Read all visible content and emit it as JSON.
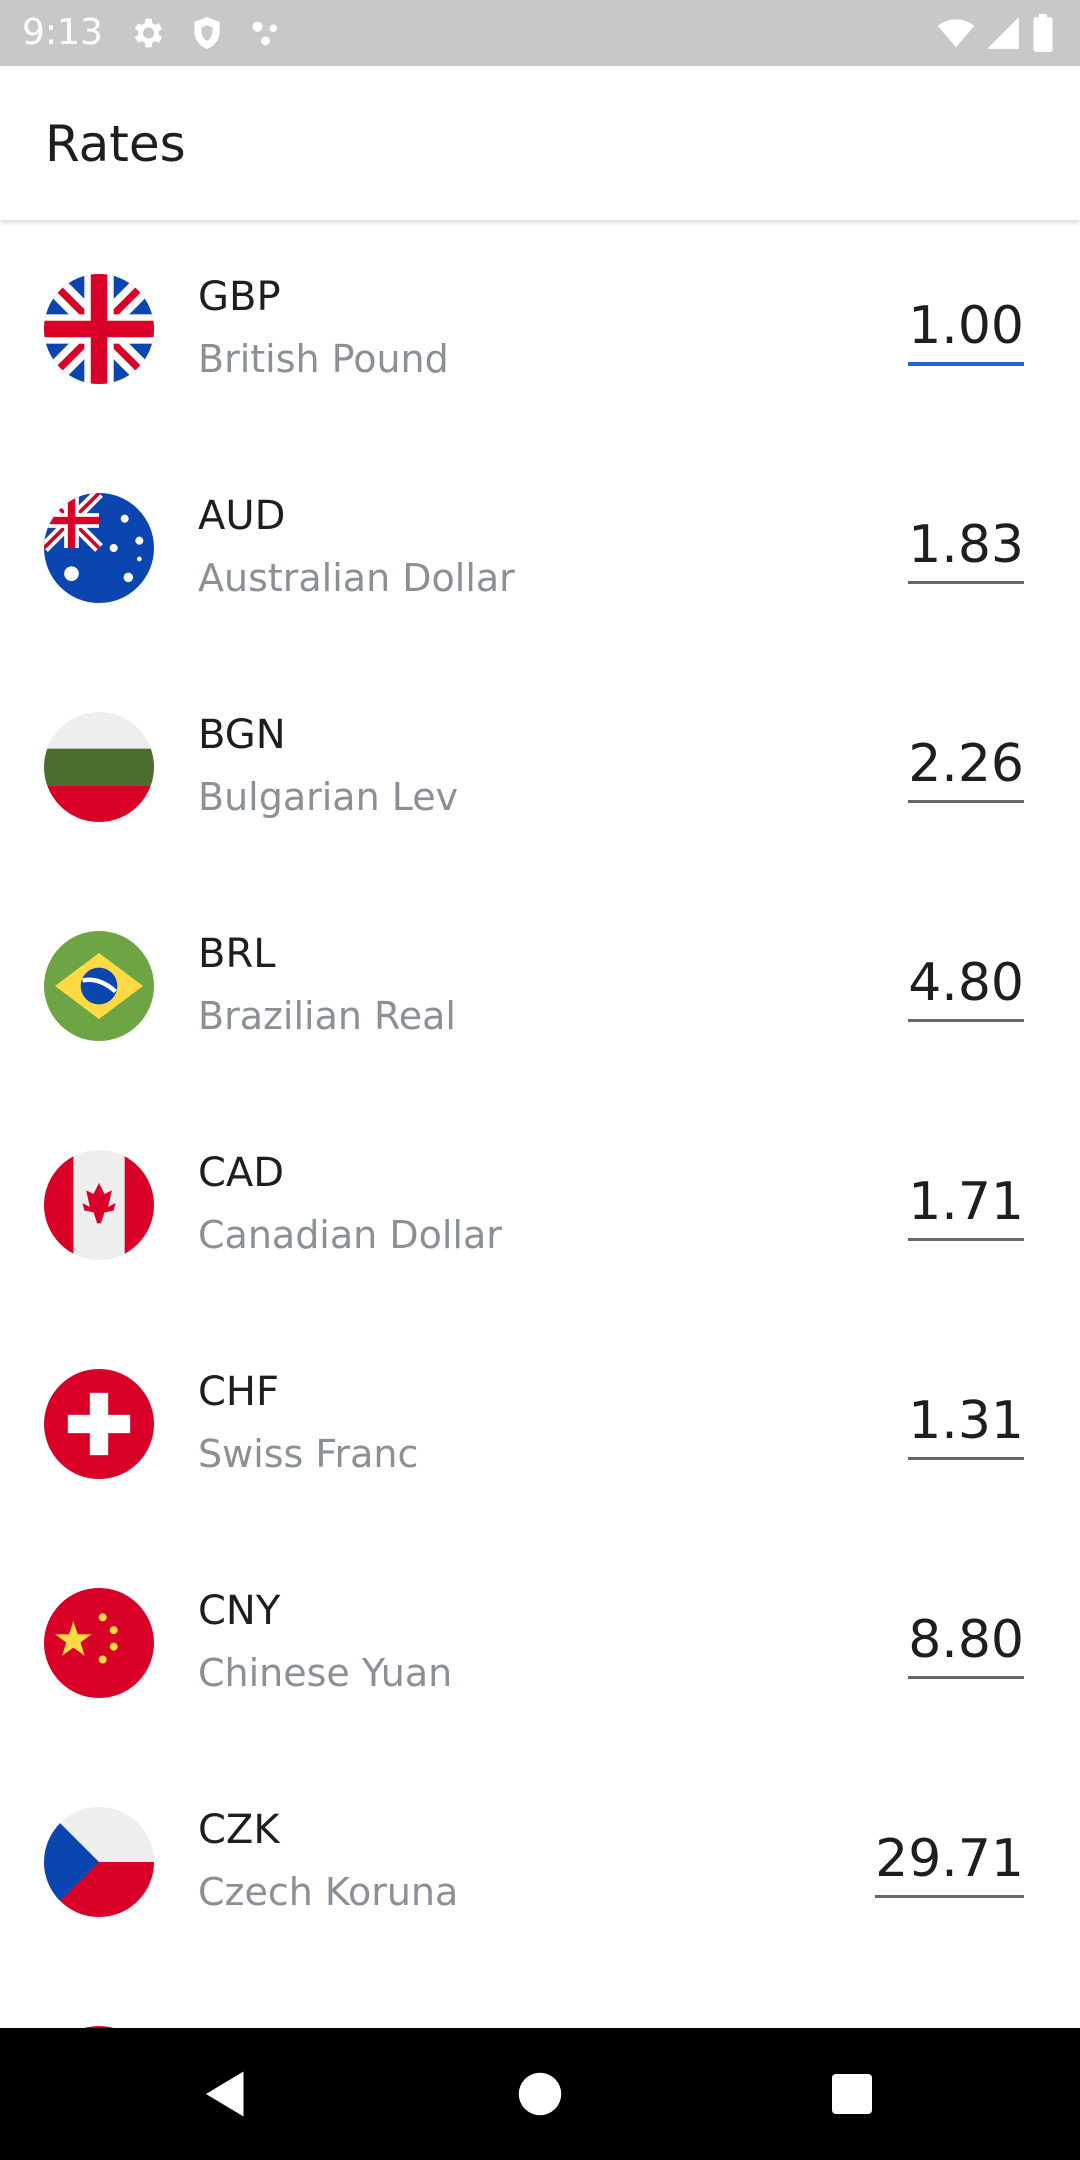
{
  "status_bar": {
    "time": "9:13",
    "icons": [
      "gear-icon",
      "shield-icon",
      "dots-icon",
      "wifi-icon",
      "signal-icon",
      "battery-icon"
    ]
  },
  "app_bar": {
    "title": "Rates"
  },
  "rates": [
    {
      "code": "GBP",
      "name": "British Pound",
      "value": "1.00",
      "flag": "uk-flag-icon"
    },
    {
      "code": "AUD",
      "name": "Australian Dollar",
      "value": "1.83",
      "flag": "australia-flag-icon"
    },
    {
      "code": "BGN",
      "name": "Bulgarian Lev",
      "value": "2.26",
      "flag": "bulgaria-flag-icon"
    },
    {
      "code": "BRL",
      "name": "Brazilian Real",
      "value": "4.80",
      "flag": "brazil-flag-icon"
    },
    {
      "code": "CAD",
      "name": "Canadian Dollar",
      "value": "1.71",
      "flag": "canada-flag-icon"
    },
    {
      "code": "CHF",
      "name": "Swiss Franc",
      "value": "1.31",
      "flag": "switzerland-flag-icon"
    },
    {
      "code": "CNY",
      "name": "Chinese Yuan",
      "value": "8.80",
      "flag": "china-flag-icon"
    },
    {
      "code": "CZK",
      "name": "Czech Koruna",
      "value": "29.71",
      "flag": "czech-flag-icon"
    }
  ],
  "colors": {
    "accent": "#2a5fd6",
    "status_bar": "#c8c8c8",
    "secondary_text": "#8a9095"
  },
  "nav_bar": {
    "buttons": [
      "back-icon",
      "home-icon",
      "recents-icon"
    ]
  }
}
